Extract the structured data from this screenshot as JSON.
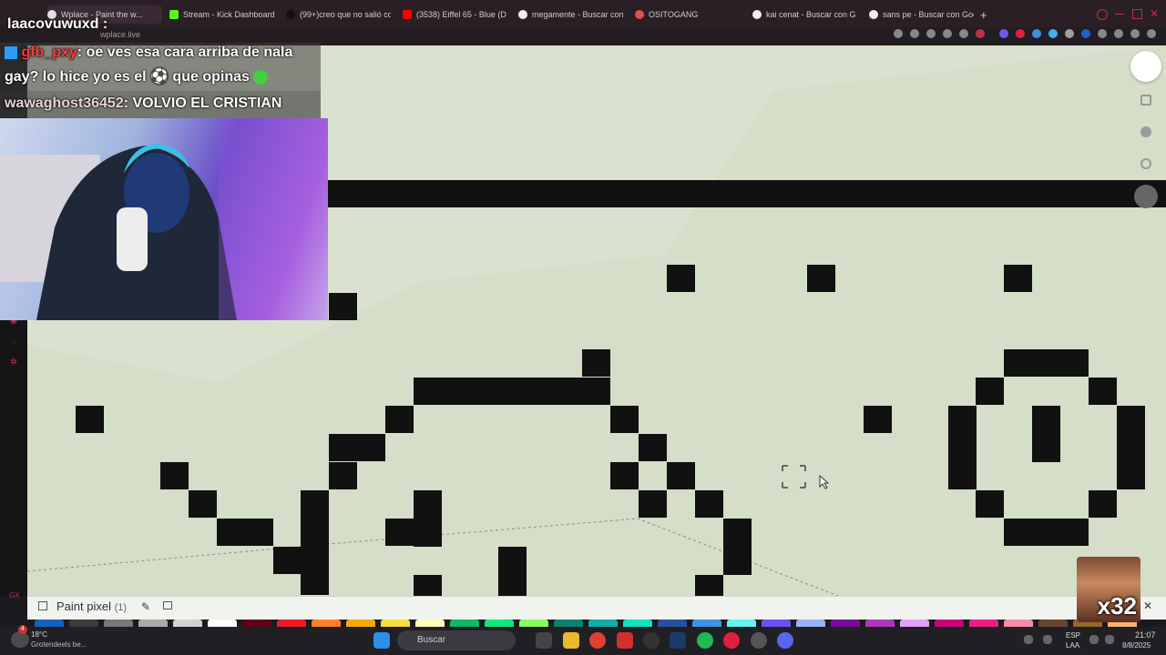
{
  "browser": {
    "tabs": [
      {
        "label": "Wplace - Paint the w...",
        "active": true
      },
      {
        "label": "Stream - Kick Dashboard",
        "active": false
      },
      {
        "label": "(99+)creo que no salió co",
        "active": false
      },
      {
        "label": "(3538) Eiffel 65 - Blue (D",
        "active": false
      },
      {
        "label": "megamente - Buscar con",
        "active": false
      },
      {
        "label": "OSITOGANG",
        "active": false
      },
      {
        "label": "kai cenat - Buscar con G",
        "active": false
      },
      {
        "label": "sans pe - Buscar con Goo",
        "active": false
      }
    ],
    "new_tab_glyph": "+",
    "address": "wplace.live"
  },
  "overlay": {
    "top_name": "laacovuwuxd :",
    "chat": [
      {
        "user": "gfb_pxy",
        "message": ": oe ves esa cara arriba de nala"
      },
      {
        "user": "",
        "message": "gay? lo hice yo es el  ⚽  que opinas"
      },
      {
        "user": "wawaghost36452",
        "message": ": VOLVIO EL CRISTIAN"
      }
    ],
    "emote_text": "x32"
  },
  "app": {
    "paint_label": "Paint pixel",
    "paint_count": "(1)",
    "close_glyph": "✕"
  },
  "taskbar": {
    "weather_temp": "18°C",
    "weather_desc": "Grotendeels be...",
    "notif_badge": "4",
    "search_placeholder": "Buscar",
    "lang_top": "ESP",
    "lang_bottom": "LAA",
    "time": "21:07",
    "date": "8/8/2025"
  },
  "colors": {
    "canvas_bg": "#d9e2cf",
    "pixel": "#111111",
    "palette": [
      "#1560c0",
      "#3c3c3c",
      "#787878",
      "#aaaaaa",
      "#d2d2d2",
      "#ffffff",
      "#600018",
      "#ed1c24",
      "#ff7f27",
      "#f6aa09",
      "#f9dd3b",
      "#fffabc",
      "#0eb968",
      "#13e67b",
      "#87ff5e",
      "#0c816e",
      "#10aea6",
      "#13e1be",
      "#28509e",
      "#4093e4",
      "#60f7f2",
      "#6b50f6",
      "#99b1fb",
      "#780c99",
      "#aa38b9",
      "#e09ff9",
      "#cb007a",
      "#ec1f80",
      "#f38da9",
      "#684634",
      "#95682a",
      "#f8b277"
    ]
  }
}
